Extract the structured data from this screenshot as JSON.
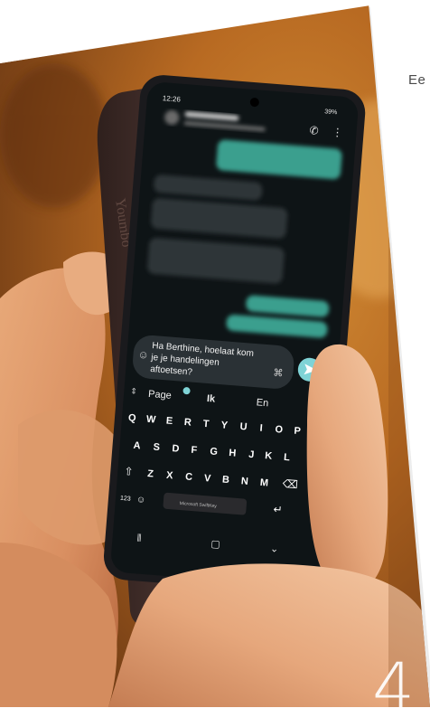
{
  "corner_text": "Ee",
  "page_number": "4",
  "phone": {
    "status_time": "12:26",
    "status_battery": "39%",
    "compose_text_line1": "Ha Berthine, hoelaat kom",
    "compose_text_line2": "je je handelingen",
    "compose_text_line3": "aftoetsen?",
    "suggestions": [
      "Page",
      "Ik",
      "En"
    ],
    "keyboard_rows": [
      [
        "Q",
        "W",
        "E",
        "R",
        "T",
        "Y",
        "U",
        "I",
        "O",
        "P"
      ],
      [
        "A",
        "S",
        "D",
        "F",
        "G",
        "H",
        "J",
        "K",
        "L"
      ],
      [
        "Z",
        "X",
        "C",
        "V",
        "B",
        "N",
        "M"
      ]
    ],
    "key_numbers": "123",
    "space_label": "Microsoft SwiftKey",
    "case_spine_text": "Youmbo"
  },
  "colors": {
    "background_warm": "#b86a22",
    "phone_body": "#1a1a1d",
    "chat_bg": "#0e1416",
    "outgoing_bubble": "#3a9f8e",
    "incoming_bubble": "#2d3538",
    "send_button": "#7fd3d6",
    "case_brown": "#3b2a26"
  }
}
